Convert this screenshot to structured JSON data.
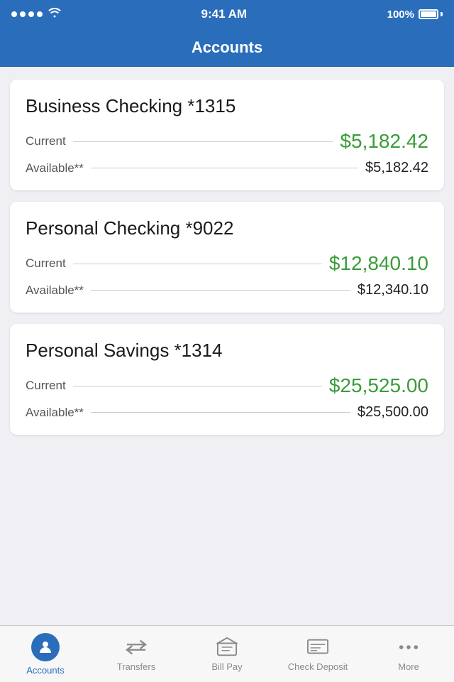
{
  "statusBar": {
    "time": "9:41 AM",
    "signal": "●●●●",
    "batteryPercent": "100%"
  },
  "navBar": {
    "title": "Accounts"
  },
  "accounts": [
    {
      "name": "Business Checking *1315",
      "currentLabel": "Current",
      "currentAmount": "$5,182.42",
      "availableLabel": "Available**",
      "availableAmount": "$5,182.42"
    },
    {
      "name": "Personal Checking *9022",
      "currentLabel": "Current",
      "currentAmount": "$12,840.10",
      "availableLabel": "Available**",
      "availableAmount": "$12,340.10"
    },
    {
      "name": "Personal Savings *1314",
      "currentLabel": "Current",
      "currentAmount": "$25,525.00",
      "availableLabel": "Available**",
      "availableAmount": "$25,500.00"
    }
  ],
  "tabBar": {
    "items": [
      {
        "id": "accounts",
        "label": "Accounts",
        "active": true
      },
      {
        "id": "transfers",
        "label": "Transfers",
        "active": false
      },
      {
        "id": "billpay",
        "label": "Bill Pay",
        "active": false
      },
      {
        "id": "checkdeposit",
        "label": "Check Deposit",
        "active": false
      },
      {
        "id": "more",
        "label": "More",
        "active": false
      }
    ]
  }
}
